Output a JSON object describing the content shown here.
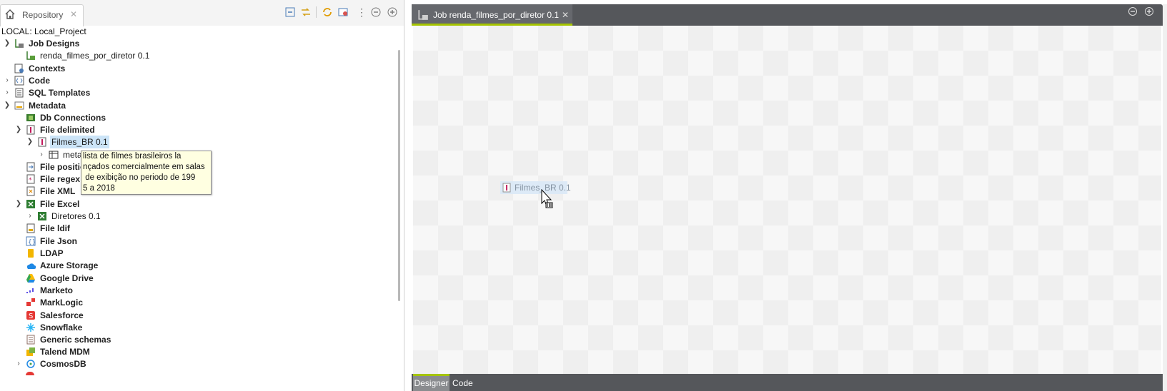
{
  "repository": {
    "tab_label": "Repository",
    "project_label": "LOCAL: Local_Project",
    "tree": [
      {
        "label": "Job Designs",
        "bold": true,
        "expanded": true,
        "icon": "job-designs-icon"
      },
      {
        "label": "renda_filmes_por_diretor 0.1",
        "bold": false,
        "icon": "job-icon"
      },
      {
        "label": "Contexts",
        "bold": true,
        "icon": "contexts-icon"
      },
      {
        "label": "Code",
        "bold": true,
        "collapsed": true,
        "icon": "code-icon"
      },
      {
        "label": "SQL Templates",
        "bold": true,
        "collapsed": true,
        "icon": "sql-templates-icon"
      },
      {
        "label": "Metadata",
        "bold": true,
        "expanded": true,
        "icon": "metadata-icon"
      },
      {
        "label": "Db Connections",
        "bold": true,
        "icon": "db-connections-icon"
      },
      {
        "label": "File delimited",
        "bold": true,
        "expanded": true,
        "icon": "file-delimited-icon"
      },
      {
        "label": "Filmes_BR 0.1",
        "bold": false,
        "expanded": true,
        "selected": true,
        "icon": "file-delimited-icon"
      },
      {
        "label": "meta",
        "bold": false,
        "collapsed": true,
        "icon": "table-icon"
      },
      {
        "label": "File positio",
        "bold": true,
        "icon": "file-positional-icon"
      },
      {
        "label": "File regex",
        "bold": true,
        "icon": "file-regex-icon"
      },
      {
        "label": "File XML",
        "bold": true,
        "icon": "file-xml-icon"
      },
      {
        "label": "File Excel",
        "bold": true,
        "expanded": true,
        "icon": "file-excel-icon"
      },
      {
        "label": "Diretores 0.1",
        "bold": false,
        "collapsed": true,
        "icon": "file-excel-icon"
      },
      {
        "label": "File ldif",
        "bold": true,
        "icon": "file-ldif-icon"
      },
      {
        "label": "File Json",
        "bold": true,
        "icon": "file-json-icon"
      },
      {
        "label": "LDAP",
        "bold": true,
        "icon": "ldap-icon"
      },
      {
        "label": "Azure Storage",
        "bold": true,
        "icon": "azure-storage-icon"
      },
      {
        "label": "Google Drive",
        "bold": true,
        "icon": "google-drive-icon"
      },
      {
        "label": "Marketo",
        "bold": true,
        "icon": "marketo-icon"
      },
      {
        "label": "MarkLogic",
        "bold": true,
        "icon": "marklogic-icon"
      },
      {
        "label": "Salesforce",
        "bold": true,
        "icon": "salesforce-icon"
      },
      {
        "label": "Snowflake",
        "bold": true,
        "icon": "snowflake-icon"
      },
      {
        "label": "Generic schemas",
        "bold": true,
        "icon": "generic-schemas-icon"
      },
      {
        "label": "Talend MDM",
        "bold": true,
        "icon": "talend-mdm-icon"
      },
      {
        "label": "CosmosDB",
        "bold": true,
        "collapsed": true,
        "icon": "cosmosdb-icon"
      }
    ],
    "tooltip_lines": [
      "lista de filmes brasileiros la",
      "nçados comercialmente em salas",
      " de exibição no periodo de 199",
      "5 a 2018"
    ]
  },
  "editor": {
    "tab_label": "Job renda_filmes_por_diretor 0.1",
    "drag_item_label": "Filmes_BR 0.1",
    "bottom_tabs": {
      "designer": "Designer",
      "code": "Code"
    }
  },
  "colors": {
    "accent": "#a5c400",
    "selection": "#cce4f7",
    "tooltip_bg": "#ffffe1",
    "dark_bar": "#55575b"
  }
}
